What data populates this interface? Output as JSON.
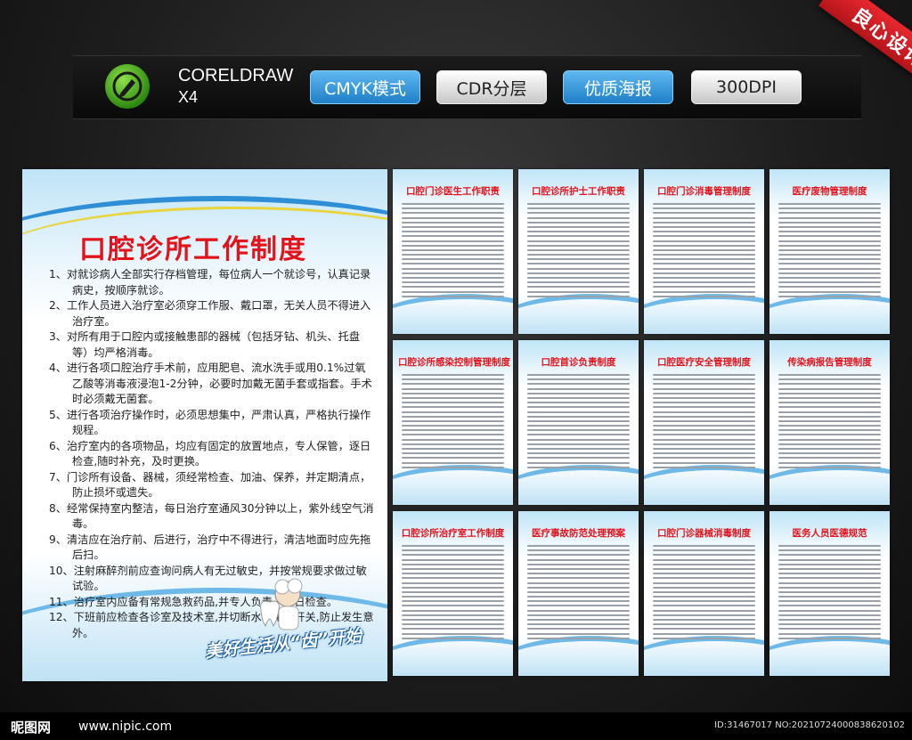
{
  "software": {
    "name": "CORELDRAW",
    "version": "X4"
  },
  "tags": [
    "CMYK模式",
    "CDR分层",
    "优质海报",
    "300DPI"
  ],
  "ribbon": "良心设计",
  "main_poster": {
    "title": "口腔诊所工作制度",
    "rules": [
      "1、对就诊病人全部实行存档管理，每位病人一个就诊号，认真记录病史，按顺序就诊。",
      "2、工作人员进入治疗室必须穿工作服、戴口罩，无关人员不得进入治疗室。",
      "3、对所有用于口腔内或接触患部的器械（包括牙钻、机头、托盘等）均严格消毒。",
      "4、进行各项口腔治疗手术前，应用肥皂、流水洗手或用0.1%过氧乙酸等消毒液浸泡1-2分钟，必要时加戴无菌手套或指套。手术时必须戴无菌套。",
      "5、进行各项治疗操作时，必须思想集中，严肃认真，严格执行操作规程。",
      "6、治疗室内的各项物品，均应有固定的放置地点，专人保管，逐日检查,随时补充，及时更换。",
      "7、门诊所有设备、器械，须经常检查、加油、保养，并定期清点，防止损坏或遗失。",
      "8、经常保持室内整洁，每日治疗室通风30分钟以上，紫外线空气消毒。",
      "9、清洁应在治疗前、后进行，治疗中不得进行，清洁地面时应先拖后扫。",
      "10、注射麻醉剂前应查询问病人有无过敏史，并按常规要求做过敏试验。",
      "11、治疗室内应备有常规急救药品,并专人负责，每日检查。",
      "12、下班前应检查各诊室及技术室,并切断水、电总开关,防止发生意外。"
    ],
    "slogan": "美好生活从“齿”开始"
  },
  "small_posters": [
    {
      "title": "口腔门诊医生工作职责"
    },
    {
      "title": "口腔诊所护士工作职责"
    },
    {
      "title": "口腔门诊消毒管理制度"
    },
    {
      "title": "医疗废物管理制度"
    },
    {
      "title": "口腔诊所感染控制管理制度"
    },
    {
      "title": "口腔首诊负责制度"
    },
    {
      "title": "口腔医疗安全管理制度"
    },
    {
      "title": "传染病报告管理制度"
    },
    {
      "title": "口腔诊所治疗室工作制度"
    },
    {
      "title": "医疗事故防范处理预案"
    },
    {
      "title": "口腔门诊器械消毒制度"
    },
    {
      "title": "医务人员医德规范"
    }
  ],
  "footer": {
    "logo": "昵图网",
    "url": "www.nipic.com",
    "id": "ID:31467017 NO:20210724000838620102"
  },
  "colors": {
    "title_red": "#e1141c",
    "accent_blue": "#2f8fd6",
    "ribbon_red": "#d81e25"
  }
}
